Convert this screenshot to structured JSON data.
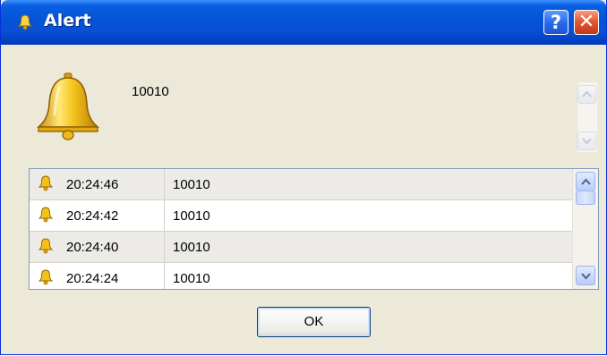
{
  "window": {
    "title": "Alert",
    "title_icon": "bell-icon",
    "help_label": "?",
    "close_label": "✕"
  },
  "alert": {
    "icon": "bell-icon",
    "message": "10010"
  },
  "log": {
    "rows": [
      {
        "time": "20:24:46",
        "message": "10010"
      },
      {
        "time": "20:24:42",
        "message": "10010"
      },
      {
        "time": "20:24:40",
        "message": "10010"
      },
      {
        "time": "20:24:24",
        "message": "10010"
      }
    ]
  },
  "buttons": {
    "ok_label": "OK"
  },
  "colors": {
    "titlebar": "#0453d6",
    "close_button": "#e35a35",
    "window_background": "#ece9d8",
    "row_shade": "#ecebe7",
    "bell_gold": "#f2c21a"
  }
}
